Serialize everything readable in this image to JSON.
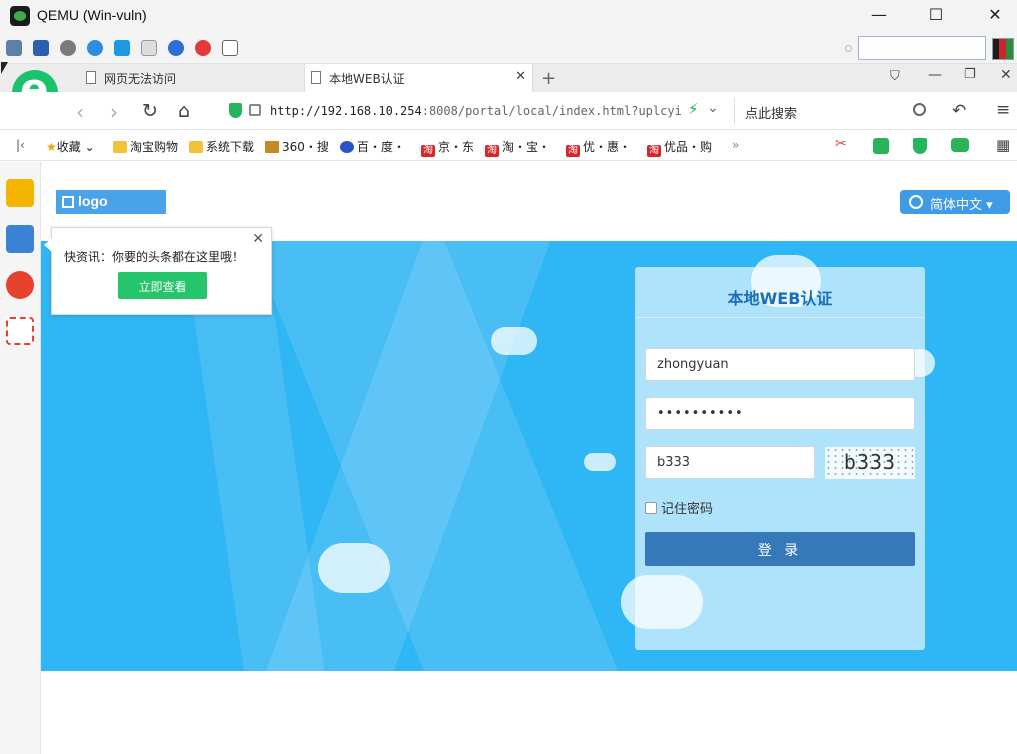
{
  "window": {
    "title": "QEMU (Win-vuln)",
    "minimize_glyph": "—",
    "maximize_glyph": "☐",
    "close_glyph": "✕"
  },
  "browser": {
    "tabs": [
      {
        "label": "网页无法访问"
      },
      {
        "label": "本地WEB认证"
      }
    ],
    "url_host": "http://192.168.10.254",
    "url_rest": ":8008/portal/local/index.html?uplcyi",
    "search_placeholder": "点此搜索",
    "bookmarks": [
      {
        "label": "收藏",
        "icon": "star-icon"
      },
      {
        "label": "淘宝购物",
        "icon": "folder-icon"
      },
      {
        "label": "系统下载",
        "icon": "folder-icon"
      },
      {
        "label": "360・搜",
        "icon": "cube-icon"
      },
      {
        "label": "百・度・",
        "icon": "paw-icon"
      },
      {
        "label": "京・东",
        "icon": "tao-icon"
      },
      {
        "label": "淘・宝・",
        "icon": "tao-icon"
      },
      {
        "label": "优・惠・",
        "icon": "tao-icon"
      },
      {
        "label": "优品・购",
        "icon": "tao-icon"
      }
    ],
    "bookmarks_more": "»",
    "tao_glyph": "淘"
  },
  "popup": {
    "text": "快资讯：你要的头条都在这里哦！",
    "button": "立即查看"
  },
  "page": {
    "logo_text": "logo",
    "language": "简体中文",
    "login": {
      "title": "本地WEB认证",
      "username": "zhongyuan",
      "password_mask": "••••••••••",
      "captcha_input": "b333",
      "captcha_image_text": "b333",
      "remember_label": "记住密码",
      "submit": "登 录"
    }
  },
  "colors": {
    "banner": "#2fb6f4",
    "login_button": "#3579b9",
    "title_blue": "#1a6fb8",
    "popup_button": "#25c56b"
  }
}
